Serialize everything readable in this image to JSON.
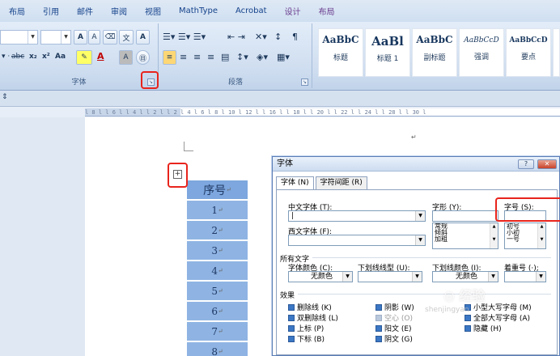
{
  "ribbon_tabs": [
    "布局",
    "引用",
    "邮件",
    "审阅",
    "视图",
    "MathType",
    "Acrobat",
    "设计",
    "布局"
  ],
  "font_group": {
    "label": "字体",
    "grow_font": "A",
    "shrink_font": "A",
    "clear_format": "A",
    "strike": "abc",
    "subscript": "x₂",
    "superscript": "x²",
    "change_case": "Aa",
    "font_color": "A",
    "char_shading": "A"
  },
  "paragraph_group": {
    "label": "段落"
  },
  "styles": [
    {
      "sample": "AaBbC",
      "name": "标题"
    },
    {
      "sample": "AaBl",
      "name": "标题 1"
    },
    {
      "sample": "AaBbC",
      "name": "副标题"
    },
    {
      "sample": "AaBbCcD",
      "name": "强调"
    },
    {
      "sample": "AaBbCcD",
      "name": "要点"
    }
  ],
  "ruler_text": "l 8 l  l 6 l  l 4 l  l 2 l      l  2  l  4  l  6  l  8  l  10  l  12  l      l 16 l  l 18 l  l 20 l  l 22 l  l 24 l      l 28 l  l 30 l",
  "table": {
    "header": "序号",
    "rows": [
      "1",
      "2",
      "3",
      "4",
      "5",
      "6",
      "7",
      "8"
    ],
    "mark": "↵",
    "handle": "+"
  },
  "dialog": {
    "title": "字体",
    "help_btn": "?",
    "close_btn": "✕",
    "tabs": [
      "字体 (N)",
      "字符间距 (R)"
    ],
    "chinese_font_label": "中文字体 (T):",
    "western_font_label": "西文字体 (F):",
    "font_style_label": "字形 (Y):",
    "font_style_options": [
      "常规",
      "倾斜",
      "加粗"
    ],
    "size_label": "字号 (S):",
    "size_options": [
      "初号",
      "小初",
      "一号"
    ],
    "all_text_label": "所有文字",
    "font_color_label": "字体颜色 (C):",
    "font_color_value": "无颜色",
    "underline_label": "下划线线型 (U):",
    "underline_color_label": "下划线颜色 (I):",
    "underline_color_value": "无颜色",
    "emphasis_label": "着重号 (·);",
    "effects_label": "效果",
    "effects": [
      {
        "label": "删除线 (K)",
        "disabled": false
      },
      {
        "label": "双删除线 (L)",
        "disabled": false
      },
      {
        "label": "上标 (P)",
        "disabled": false
      },
      {
        "label": "下标 (B)",
        "disabled": false
      },
      {
        "label": "阴影 (W)",
        "disabled": false
      },
      {
        "label": "空心 (O)",
        "disabled": true
      },
      {
        "label": "阳文 (E)",
        "disabled": false
      },
      {
        "label": "阴文 (G)",
        "disabled": false
      },
      {
        "label": "小型大写字母 (M)",
        "disabled": false
      },
      {
        "label": "全部大写字母 (A)",
        "disabled": false
      },
      {
        "label": "隐藏 (H)",
        "disabled": false
      }
    ]
  },
  "watermark": "shenjingyan",
  "colors": {
    "highlight": "#e8241c",
    "table_cell": "#8fb4e3",
    "ribbon": "#cddcef"
  }
}
